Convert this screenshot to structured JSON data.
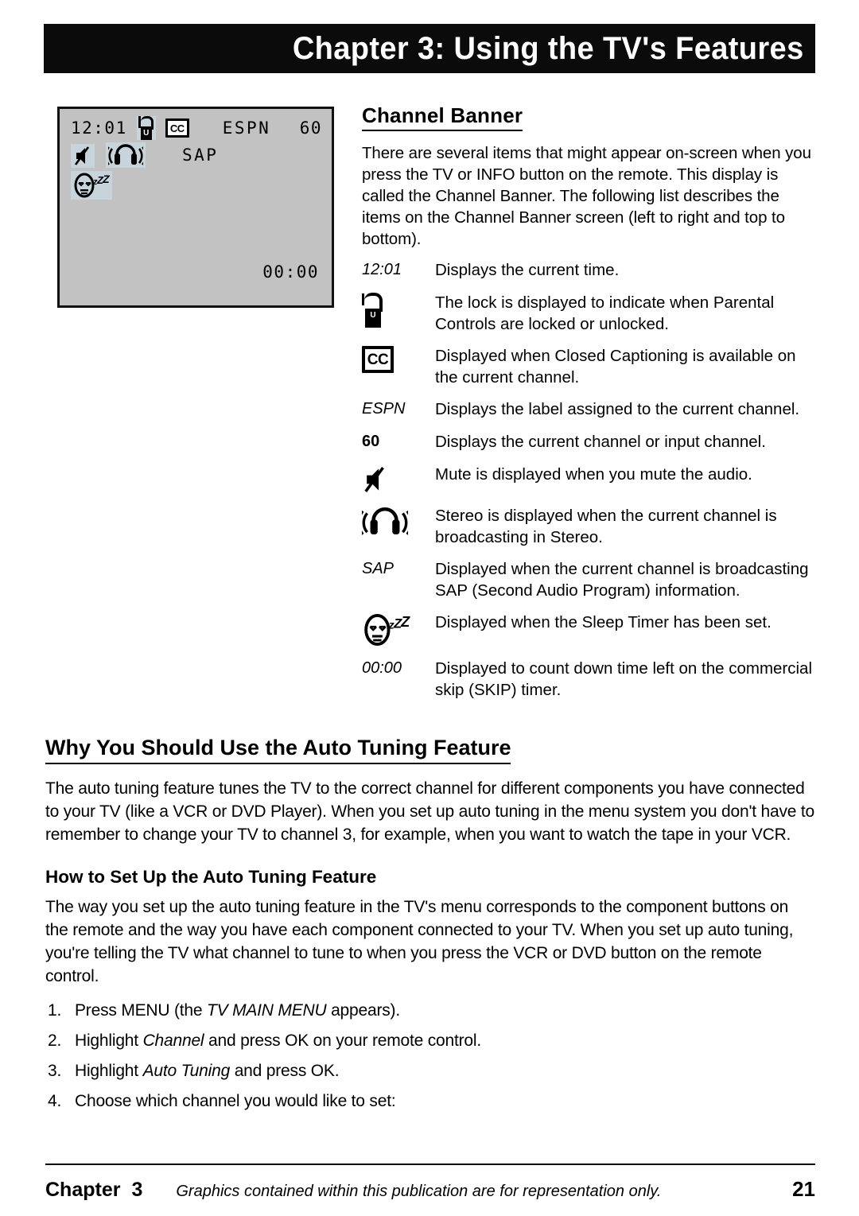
{
  "header": {
    "title": "Chapter 3: Using the TV's Features"
  },
  "tv_banner": {
    "time": "12:01",
    "lock_icon": "padlock-unlocked-icon",
    "cc_icon": "closed-caption-icon",
    "channel_label": "ESPN",
    "channel_number": "60",
    "mute_icon": "mute-icon",
    "stereo_icon": "stereo-headphones-icon",
    "sap_label": "SAP",
    "sleep_icon": "sleep-timer-icon",
    "skip_timer": "00:00"
  },
  "channel_banner": {
    "heading": "Channel Banner",
    "intro": "There are several items that might appear on-screen when you press the TV or INFO button on the remote. This display is called the Channel Banner. The following list describes the items on the Channel Banner screen (left to right and top to bottom).",
    "items": [
      {
        "term": "12:01",
        "term_style": "italic",
        "description": "Displays the current time."
      },
      {
        "term": "",
        "term_style": "icon",
        "icon": "padlock-unlocked-icon",
        "description": "The lock is displayed to indicate when Parental Controls are locked or unlocked."
      },
      {
        "term": "",
        "term_style": "icon",
        "icon": "closed-caption-icon",
        "description": "Displayed when Closed Captioning is available on the current channel."
      },
      {
        "term": "ESPN",
        "term_style": "italic",
        "description": "Displays the label assigned to the current channel."
      },
      {
        "term": "60",
        "term_style": "bold",
        "description": "Displays the current channel or input channel."
      },
      {
        "term": "",
        "term_style": "icon",
        "icon": "mute-icon",
        "description": "Mute is displayed when you mute the audio."
      },
      {
        "term": "",
        "term_style": "icon",
        "icon": "stereo-headphones-icon",
        "description": "Stereo is displayed when the current channel is broadcasting in Stereo."
      },
      {
        "term": "SAP",
        "term_style": "italic",
        "description": "Displayed when the current channel is broadcasting SAP (Second Audio Program) information."
      },
      {
        "term": "",
        "term_style": "icon",
        "icon": "sleep-timer-icon",
        "description": "Displayed when the Sleep Timer has been set."
      },
      {
        "term": "00:00",
        "term_style": "italic",
        "description": "Displayed to count down time left on the commercial skip (SKIP) timer."
      }
    ]
  },
  "auto_tuning": {
    "heading": "Why You Should Use the Auto Tuning Feature",
    "paragraph": "The auto tuning feature tunes the TV to the correct channel for different components you have connected to your TV (like a VCR or DVD Player). When you set up auto tuning in the menu system you don't have to remember to change your TV to channel 3, for example, when you want to watch the tape in your VCR.",
    "subheading": "How to Set Up the Auto Tuning Feature",
    "sub_paragraph": "The way you set up the auto tuning feature in the TV's menu corresponds to the component buttons on the remote and the way you have each component connected to your TV. When you set up auto tuning, you're telling the TV what channel to tune to when you press the VCR or DVD button on the remote control.",
    "steps": [
      {
        "num": "1.",
        "pre": "Press MENU (the ",
        "emphasis": "TV MAIN MENU",
        "post": " appears)."
      },
      {
        "num": "2.",
        "pre": "Highlight ",
        "emphasis": "Channel",
        "post": " and press OK on your remote control."
      },
      {
        "num": "3.",
        "pre": "Highlight ",
        "emphasis": "Auto Tuning",
        "post": " and press OK."
      },
      {
        "num": "4.",
        "pre": "Choose which channel you would like to set:",
        "emphasis": "",
        "post": ""
      }
    ]
  },
  "footer": {
    "chapter_label": "Chapter",
    "chapter_number": "3",
    "note": "Graphics contained within this publication are for representation only.",
    "page_number": "21"
  },
  "colors": {
    "header_bar": "#0b0b0b",
    "tv_screen_bg": "#c2c2c2",
    "icon_highlight": "#c8d4dc",
    "text": "#000000"
  }
}
